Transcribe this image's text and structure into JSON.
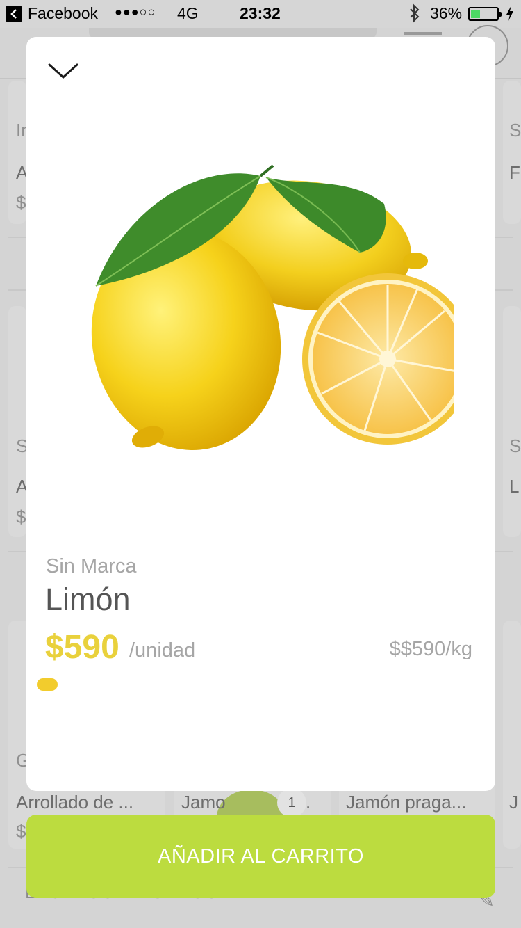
{
  "status_bar": {
    "back_app": "Facebook",
    "signal": "●●●○○",
    "network": "4G",
    "time": "23:32",
    "battery_percent": "36%",
    "battery_level": 0.36,
    "battery_color": "#4cd964"
  },
  "background": {
    "rows": [
      {
        "left_top": "In",
        "left_name": "A",
        "left_price": "$",
        "right_top": "S",
        "right_name": "F"
      },
      {
        "left_top": "S",
        "left_name": "A",
        "left_price": "$",
        "right_top": "S",
        "right_name": "L"
      },
      {
        "left_top": "G",
        "left_name": "Arrollado de ...",
        "left_price": "$",
        "mid_name": "Jamo",
        "mid_tail": ".",
        "right_name": "Jamón praga...",
        "right_edge": "J"
      }
    ],
    "cart_badge": "1",
    "footer": "LACTEOS Y HUEVOS"
  },
  "modal": {
    "close_icon": "chevron-down-icon",
    "image": "lemons-image",
    "brand": "Sin Marca",
    "name": "Limón",
    "price": "$590",
    "unit": "/unidad",
    "price_per_kg": "$$590/kg",
    "accent_color": "#e9d13c"
  },
  "cta": {
    "label": "AÑADIR AL CARRITO",
    "color": "#bcdc3f"
  }
}
